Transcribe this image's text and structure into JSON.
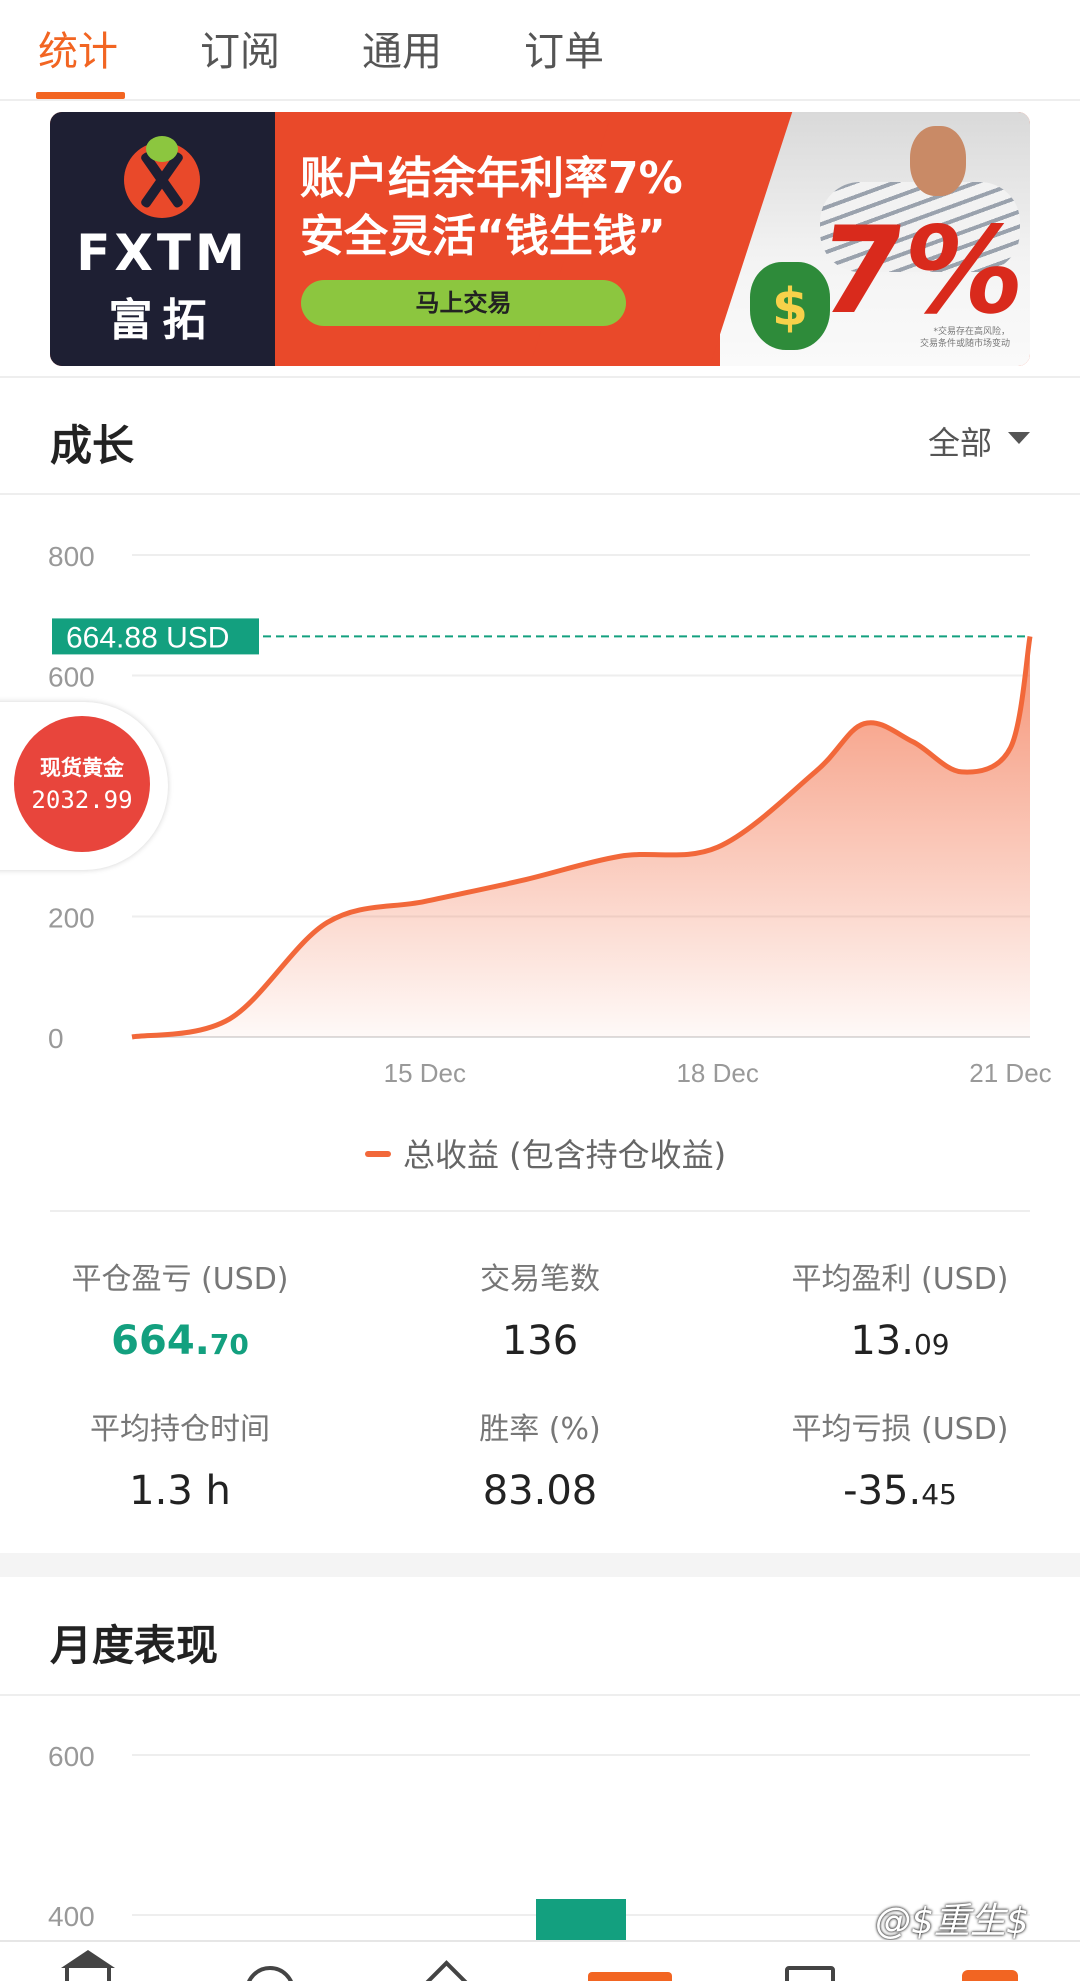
{
  "tabs": [
    {
      "label": "统计",
      "active": true
    },
    {
      "label": "订阅",
      "active": false
    },
    {
      "label": "通用",
      "active": false
    },
    {
      "label": "订单",
      "active": false
    }
  ],
  "banner": {
    "brand": "FXTM",
    "brand_cn": "富拓",
    "headline_1": "账户结余年利率7%",
    "headline_2": "安全灵活“钱生钱”",
    "cta": "马上交易",
    "big_figure": "7%",
    "disclaimer_1": "*交易存在高风险，",
    "disclaimer_2": "交易条件或随市场变动"
  },
  "growth": {
    "title": "成长",
    "filter": "全部",
    "current_label": "664.88 USD",
    "legend": "总收益 (包含持仓收益)"
  },
  "gold_badge": {
    "name": "现货黄金",
    "price": "2032.99"
  },
  "stats": [
    {
      "label": "平仓盈亏 (USD)",
      "int": "664.",
      "dec": "70",
      "green": true
    },
    {
      "label": "交易笔数",
      "int": "136",
      "dec": "",
      "green": false
    },
    {
      "label": "平均盈利 (USD)",
      "int": "13.",
      "dec": "09",
      "green": false
    },
    {
      "label": "平均持仓时间",
      "int": "1.3 h",
      "dec": "",
      "green": false
    },
    {
      "label": "胜率 (%)",
      "int": "83.08",
      "dec": "",
      "green": false
    },
    {
      "label": "平均亏损 (USD)",
      "int": "-35.",
      "dec": "45",
      "green": false
    }
  ],
  "monthly": {
    "title": "月度表现"
  },
  "watermark": "@$重生$",
  "colors": {
    "accent": "#f26522",
    "line": "#f2683a",
    "green": "#13a07f",
    "gold_badge": "#e8453c"
  },
  "chart_data": [
    {
      "type": "area",
      "series": [
        {
          "name": "总收益 (包含持仓收益)",
          "color": "#f2683a",
          "x": [
            "12 Dec",
            "13 Dec",
            "14 Dec",
            "15 Dec",
            "16 Dec",
            "17 Dec",
            "18 Dec",
            "19 Dec",
            "19.5 Dec",
            "20 Dec",
            "20.5 Dec",
            "21 Dec",
            "21.2 Dec"
          ],
          "y": [
            0,
            30,
            190,
            225,
            260,
            300,
            315,
            440,
            520,
            490,
            440,
            480,
            664.88
          ]
        }
      ],
      "xticks": [
        "15 Dec",
        "18 Dec",
        "21 Dec"
      ],
      "yticks": [
        0,
        200,
        600,
        800
      ],
      "ylim": [
        0,
        800
      ],
      "reference_line": 664.88,
      "grid": true,
      "legend": "bottom-center"
    },
    {
      "type": "bar",
      "yticks": [
        400,
        600
      ],
      "ylim": [
        200,
        600
      ],
      "bars": [
        {
          "color": "#13a07f",
          "value": 420
        }
      ],
      "grid": true
    }
  ]
}
